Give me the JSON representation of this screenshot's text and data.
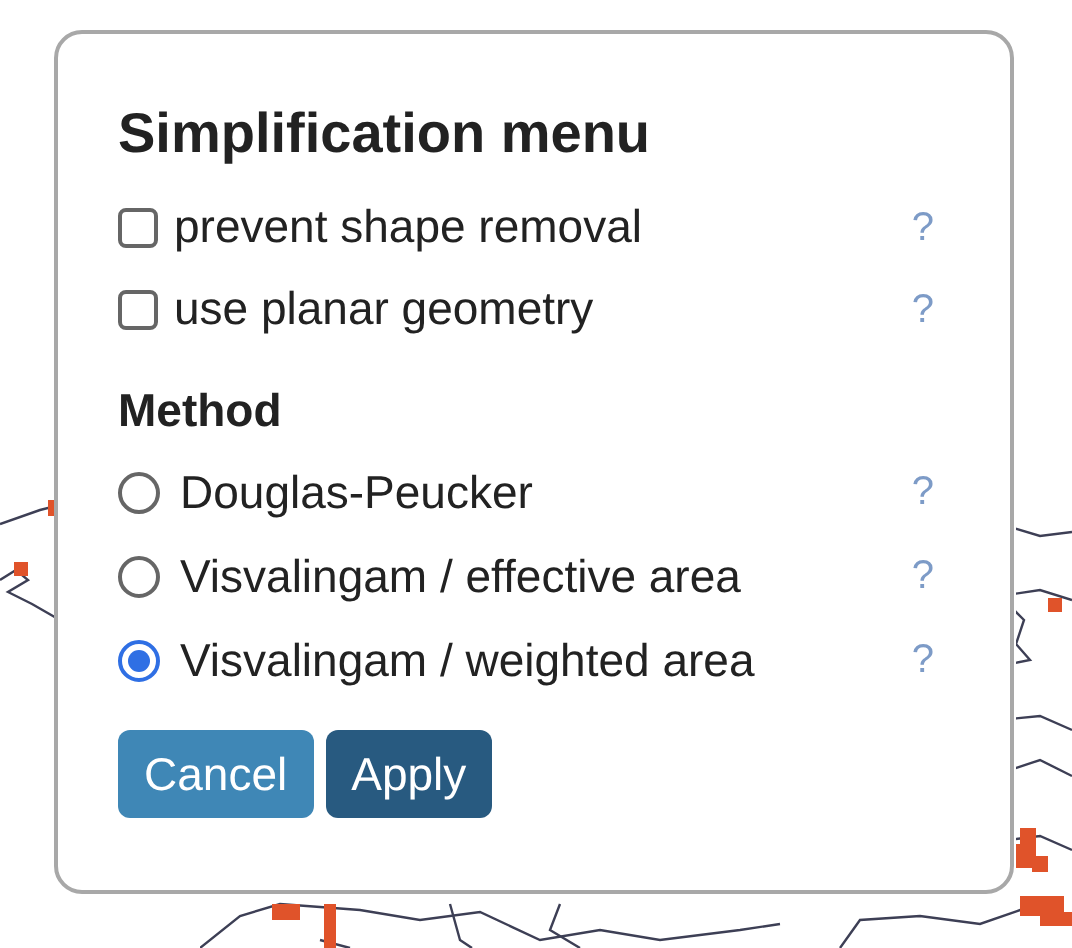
{
  "dialog": {
    "title": "Simplification menu",
    "options": [
      {
        "label": "prevent shape removal",
        "checked": false,
        "help": "?"
      },
      {
        "label": "use planar geometry",
        "checked": false,
        "help": "?"
      }
    ],
    "method": {
      "heading": "Method",
      "choices": [
        {
          "label": "Douglas-Peucker",
          "selected": false,
          "help": "?"
        },
        {
          "label": "Visvalingam / effective area",
          "selected": false,
          "help": "?"
        },
        {
          "label": "Visvalingam / weighted area",
          "selected": true,
          "help": "?"
        }
      ]
    },
    "buttons": [
      {
        "label": "Cancel",
        "kind": "secondary"
      },
      {
        "label": "Apply",
        "kind": "primary"
      }
    ]
  }
}
